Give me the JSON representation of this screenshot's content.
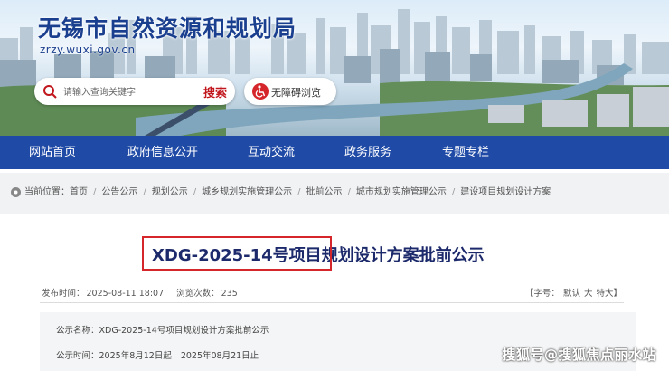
{
  "header": {
    "site_title": "无锡市自然资源和规划局",
    "site_url": "zrzy.wuxi.gov.cn",
    "search_placeholder": "请输入查询关键字",
    "search_button": "搜索",
    "accessibility_button": "无障碍浏览"
  },
  "nav": {
    "items": [
      "网站首页",
      "政府信息公开",
      "互动交流",
      "政务服务",
      "专题专栏"
    ]
  },
  "breadcrumb": {
    "prefix": "当前位置：",
    "items": [
      "首页",
      "公告公示",
      "规划公示",
      "城乡规划实施管理公示",
      "批前公示",
      "城市规划实施管理公示",
      "建设项目规划设计方案"
    ]
  },
  "article": {
    "title_highlight": "XDG-2025-14号项目",
    "title_rest": "规划设计方案批前公示",
    "publish_label": "发布时间：",
    "publish_time": "2025-08-11 18:07",
    "views_label": "浏览次数：",
    "views": "235",
    "font_size_label": "【字号：",
    "font_options": [
      "默认",
      "大",
      "特大"
    ],
    "font_size_close": "】",
    "notice_name_label": "公示名称：",
    "notice_name": "XDG-2025-14号项目规划设计方案批前公示",
    "notice_time_label": "公示时间：",
    "notice_time_start": "2025年8月12日起",
    "notice_time_end": "2025年08月21日止"
  },
  "watermark": "搜狐号@搜狐焦点丽水站",
  "colors": {
    "nav_bg": "#1f4aa6",
    "title_blue": "#1b3f8f",
    "accent_red": "#d5262b"
  }
}
